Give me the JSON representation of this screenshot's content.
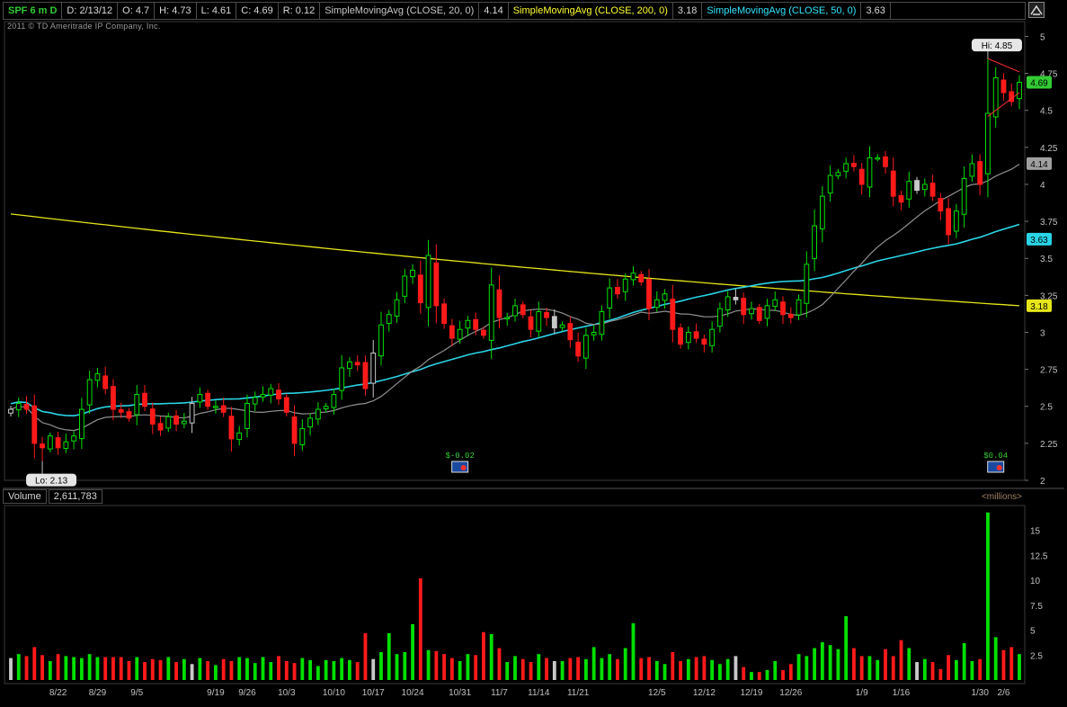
{
  "header": {
    "symbol": "SPF 6 m D",
    "date": "D: 2/13/12",
    "open": "O: 4.7",
    "high": "H: 4.73",
    "low": "L: 4.61",
    "close": "C: 4.69",
    "range": "R: 0.12",
    "sma20_label": "SimpleMovingAvg (CLOSE, 20, 0)",
    "sma20_value": "4.14",
    "sma200_label": "SimpleMovingAvg (CLOSE, 200, 0)",
    "sma200_value": "3.18",
    "sma50_label": "SimpleMovingAvg (CLOSE, 50, 0)",
    "sma50_value": "3.63"
  },
  "copyright": "2011 © TD Ameritrade IP Company, Inc.",
  "volume_header": {
    "label": "Volume",
    "value": "2,611,783",
    "units": "<millions>"
  },
  "colors": {
    "up": "#00e000",
    "down": "#ff1a1a",
    "neutral": "#c8c8c8",
    "sma20": "#909090",
    "sma50": "#2ad4e6",
    "sma200": "#e6e61a",
    "axis_text": "#c0c0c0"
  },
  "chart_data": [
    {
      "type": "candlestick",
      "ylim": [
        2,
        5.1
      ],
      "yticks": [
        "2",
        "2.25",
        "2.5",
        "2.75",
        "3",
        "3.25",
        "3.5",
        "3.75",
        "4",
        "4.25",
        "4.5",
        "4.75",
        "5"
      ],
      "xticks": [
        "8/22",
        "8/29",
        "9/5",
        "9/19",
        "9/26",
        "10/3",
        "10/10",
        "10/17",
        "10/24",
        "10/31",
        "11/7",
        "11/14",
        "11/21",
        "12/5",
        "12/12",
        "12/19",
        "12/26",
        "1/9",
        "1/16",
        "1/30",
        "2/6"
      ],
      "annotations": {
        "high": "Hi: 4.85",
        "low": "Lo: 2.13",
        "earnings1": "$-0.02",
        "earnings2": "$0.04"
      },
      "price_labels": {
        "last": "4.69",
        "sma20": "4.14",
        "sma50": "3.63",
        "sma200": "3.18"
      },
      "closes": [
        2.48,
        2.52,
        2.48,
        2.25,
        2.22,
        2.3,
        2.22,
        2.26,
        2.3,
        2.48,
        2.68,
        2.72,
        2.62,
        2.48,
        2.46,
        2.42,
        2.58,
        2.5,
        2.38,
        2.34,
        2.43,
        2.38,
        2.4,
        2.52,
        2.58,
        2.5,
        2.5,
        2.46,
        2.28,
        2.32,
        2.52,
        2.56,
        2.58,
        2.62,
        2.55,
        2.46,
        2.25,
        2.35,
        2.42,
        2.48,
        2.5,
        2.58,
        2.76,
        2.8,
        2.78,
        2.62,
        2.86,
        3.05,
        3.12,
        3.22,
        3.38,
        3.42,
        3.2,
        3.52,
        3.18,
        3.06,
        2.96,
        3.02,
        3.08,
        3.02,
        2.98,
        3.32,
        3.1,
        3.1,
        3.18,
        3.12,
        3.02,
        3.14,
        3.1,
        3.03,
        3.05,
        2.95,
        2.84,
        2.98,
        3.0,
        3.14,
        3.3,
        3.26,
        3.36,
        3.4,
        3.34,
        3.16,
        3.22,
        3.26,
        3.02,
        2.92,
        3.0,
        2.96,
        2.92,
        3.02,
        3.16,
        3.24,
        3.22,
        3.12,
        3.16,
        3.08,
        3.18,
        3.22,
        3.12,
        3.1,
        3.22,
        3.46,
        3.72,
        3.92,
        4.06,
        4.08,
        4.14,
        4.12,
        4.0,
        4.18,
        4.18,
        4.12,
        3.92,
        3.88,
        4.02,
        3.96,
        4.0,
        3.92,
        3.82,
        3.66,
        3.82,
        4.04,
        4.14,
        4.0,
        4.48,
        4.72,
        4.62,
        4.56,
        4.69
      ],
      "volumes": [
        2.2,
        2.6,
        2.4,
        3.3,
        2.5,
        1.9,
        2.6,
        2.4,
        2.3,
        2.2,
        2.6,
        2.3,
        2.3,
        2.3,
        2.3,
        1.9,
        2.3,
        1.8,
        2.1,
        2.0,
        2.3,
        1.8,
        2.1,
        1.6,
        2.2,
        1.9,
        1.5,
        2.1,
        1.9,
        2.3,
        2.2,
        1.7,
        2.3,
        1.8,
        2.4,
        1.9,
        1.7,
        2.2,
        2.0,
        1.4,
        2.0,
        1.9,
        2.2,
        2.0,
        1.8,
        4.7,
        2.1,
        2.8,
        4.7,
        2.6,
        2.8,
        5.6,
        10.2,
        3.0,
        2.9,
        2.6,
        2.2,
        1.9,
        2.6,
        2.5,
        4.8,
        4.6,
        3.2,
        1.8,
        2.4,
        2.1,
        1.8,
        2.6,
        2.2,
        1.9,
        1.9,
        2.2,
        2.3,
        2.1,
        3.3,
        2.2,
        2.6,
        2.1,
        3.2,
        5.7,
        2.2,
        2.3,
        1.9,
        1.6,
        2.8,
        1.9,
        2.1,
        2.3,
        2.4,
        2.0,
        1.6,
        2.1,
        2.4,
        1.3,
        0.8,
        0.8,
        1.0,
        1.9,
        1.0,
        1.6,
        2.6,
        2.4,
        3.2,
        3.8,
        3.5,
        3.1,
        6.4,
        3.2,
        2.4,
        2.4,
        2.0,
        3.1,
        2.4,
        4.0,
        3.2,
        1.8,
        2.1,
        1.8,
        1.1,
        2.5,
        2.0,
        3.7,
        1.9,
        2.1,
        16.8,
        4.3,
        3.0,
        3.3,
        2.6
      ],
      "volume_ylim": [
        0,
        17.5
      ],
      "volume_yticks": [
        "2.5",
        "5",
        "7.5",
        "10",
        "12.5",
        "15"
      ]
    }
  ]
}
